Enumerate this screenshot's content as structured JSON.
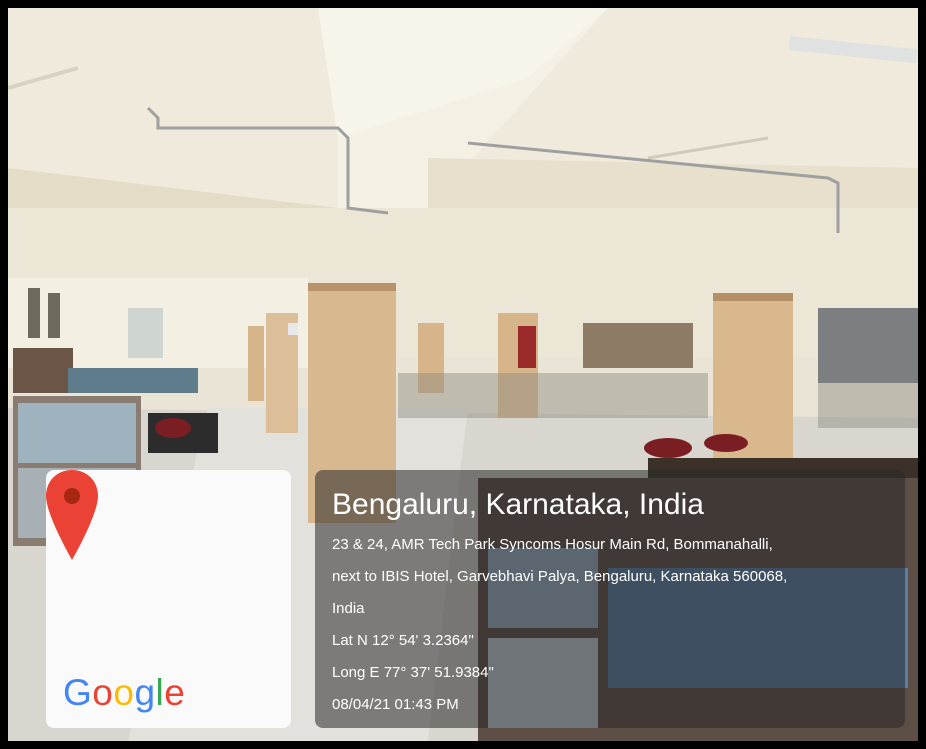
{
  "geotag": {
    "city_line": "Bengaluru, Karnataka, India",
    "address_line1": "23 & 24, AMR Tech Park Syncoms Hosur Main Rd, Bommanahalli,",
    "address_line2": "next to IBIS Hotel, Garvebhavi Palya, Bengaluru, Karnataka 560068,",
    "address_line3": "India",
    "latitude": "Lat N 12° 54' 3.2364\"",
    "longitude": "Long E 77° 37' 51.9384\"",
    "timestamp": "08/04/21 01:43 PM"
  },
  "map_card": {
    "logo_text": "Google",
    "icon": "location-pin-icon",
    "pin_color": "#EA4335"
  }
}
